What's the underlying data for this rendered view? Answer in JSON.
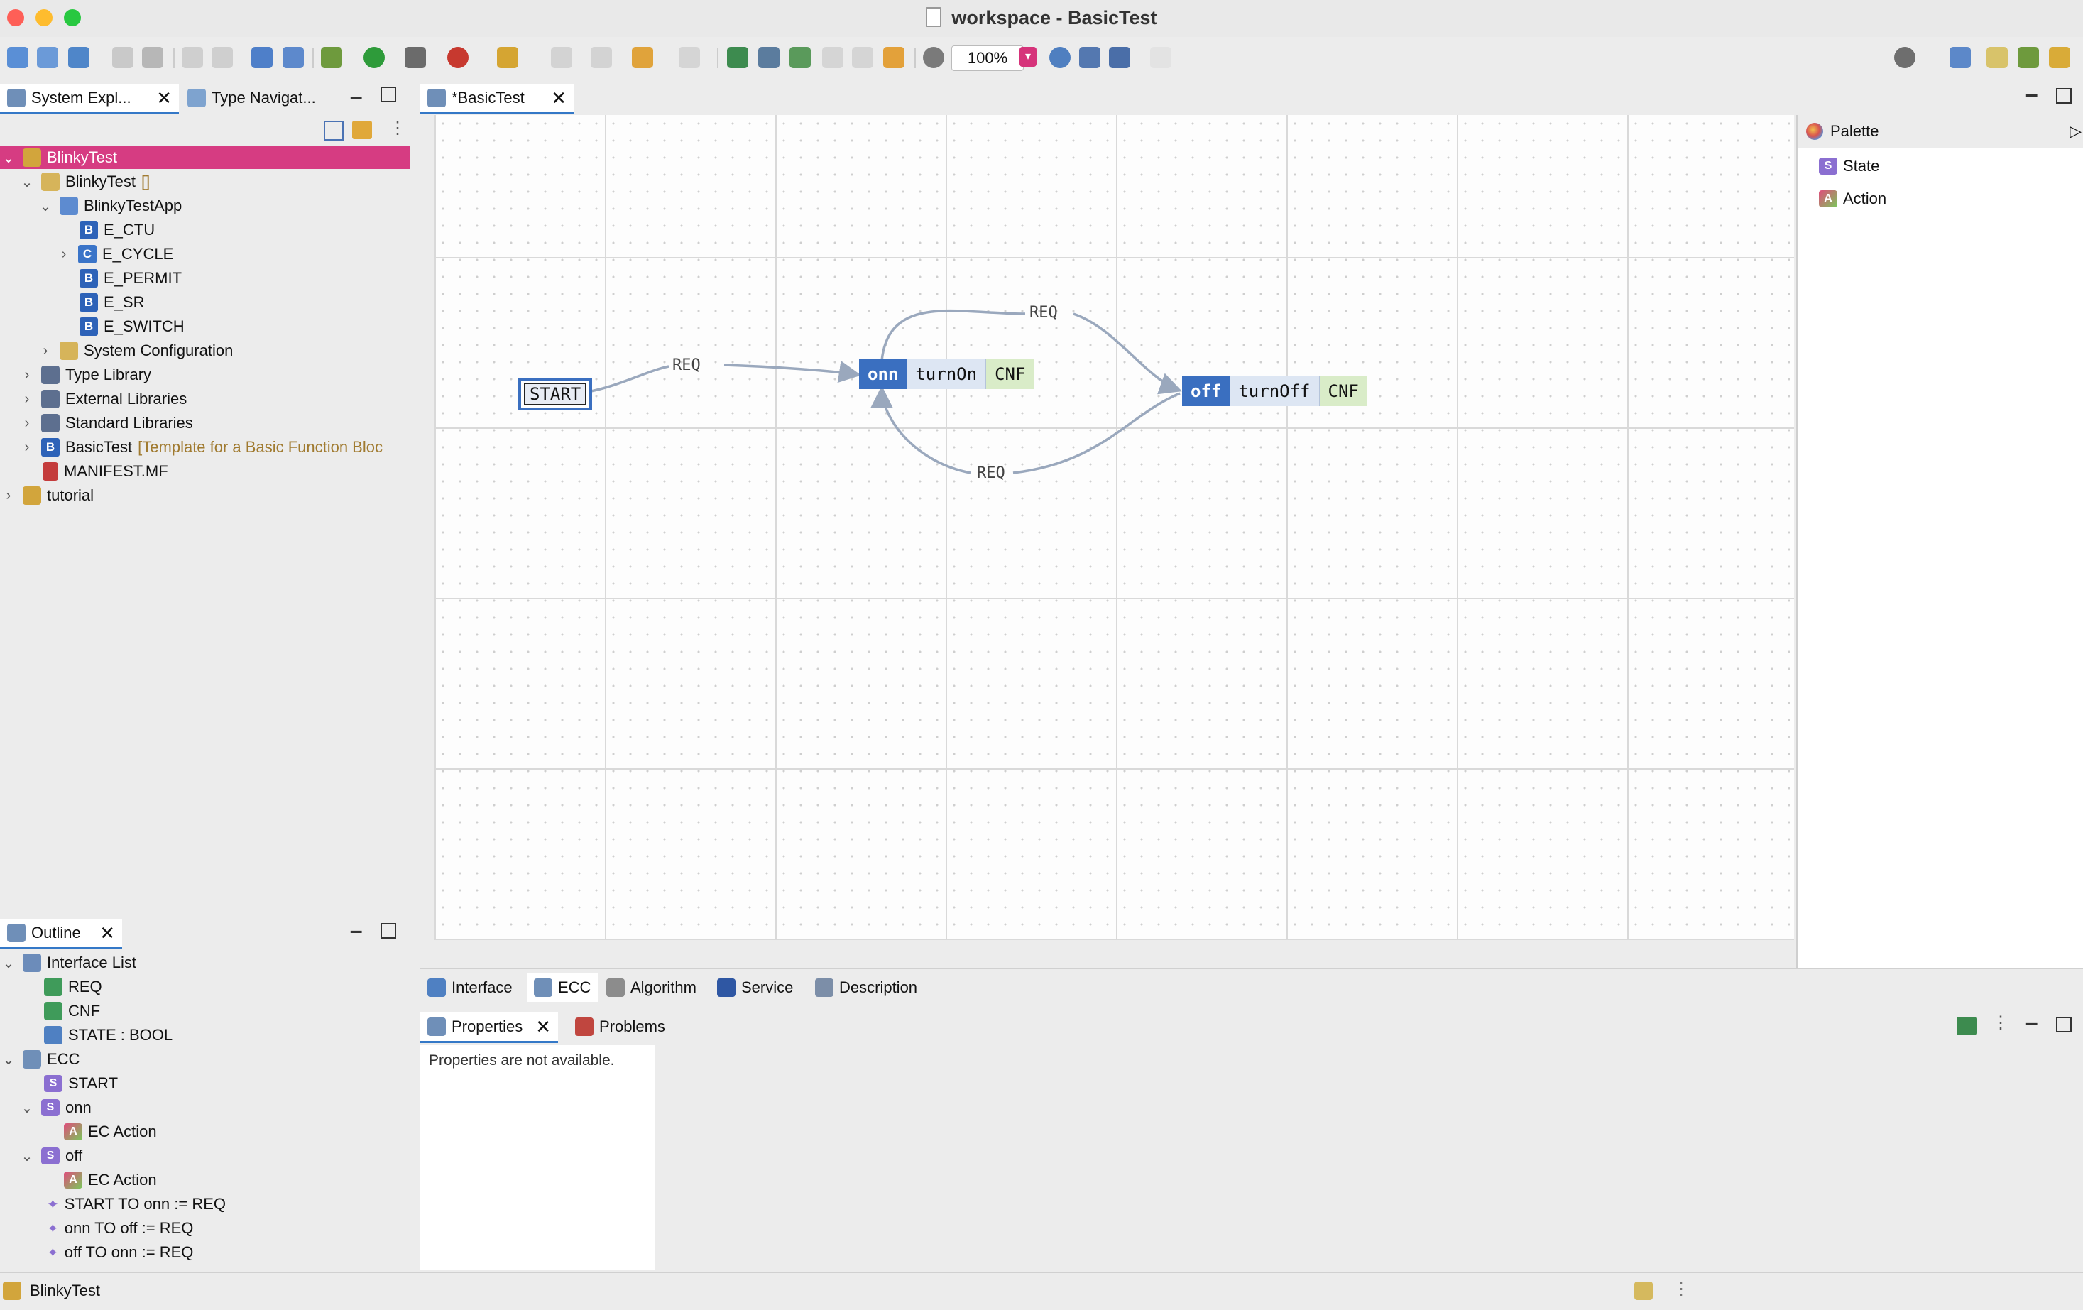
{
  "window": {
    "title": "workspace - BasicTest"
  },
  "toolbar": {
    "zoom": "100%"
  },
  "left_tabs": [
    {
      "label": "System Expl..."
    },
    {
      "label": "Type Navigat..."
    }
  ],
  "tree": [
    {
      "label": "BlinkyTest",
      "suffix": ""
    },
    {
      "label": "BlinkyTest",
      "suffix": "[]"
    },
    {
      "label": "BlinkyTestApp",
      "suffix": ""
    },
    {
      "label": "E_CTU",
      "suffix": ""
    },
    {
      "label": "E_CYCLE",
      "suffix": ""
    },
    {
      "label": "E_PERMIT",
      "suffix": ""
    },
    {
      "label": "E_SR",
      "suffix": ""
    },
    {
      "label": "E_SWITCH",
      "suffix": ""
    },
    {
      "label": "System Configuration",
      "suffix": ""
    },
    {
      "label": "Type Library",
      "suffix": ""
    },
    {
      "label": "External Libraries",
      "suffix": ""
    },
    {
      "label": "Standard Libraries",
      "suffix": ""
    },
    {
      "label": "BasicTest",
      "suffix": "[Template for a Basic Function Bloc"
    },
    {
      "label": "MANIFEST.MF",
      "suffix": ""
    },
    {
      "label": "tutorial",
      "suffix": ""
    }
  ],
  "outline": {
    "tab": "Outline",
    "items": [
      "Interface List",
      "REQ",
      "CNF",
      "STATE : BOOL",
      "ECC",
      "START",
      "onn",
      "EC Action",
      "off",
      "EC Action",
      "START TO onn := REQ",
      "onn TO off := REQ",
      "off TO onn := REQ"
    ]
  },
  "editor": {
    "tab": "*BasicTest",
    "states": {
      "start": "START",
      "onn": {
        "name": "onn",
        "algorithm": "turnOn",
        "output": "CNF"
      },
      "off": {
        "name": "off",
        "algorithm": "turnOff",
        "output": "CNF"
      }
    },
    "transitions": {
      "t1": "REQ",
      "t2": "REQ",
      "t3": "REQ"
    }
  },
  "palette": {
    "title": "Palette",
    "items": [
      "State",
      "Action"
    ]
  },
  "editor_tabs": [
    "Interface",
    "ECC",
    "Algorithm",
    "Service",
    "Description"
  ],
  "bottom_tabs": {
    "properties": "Properties",
    "problems": "Problems",
    "message": "Properties are not available."
  },
  "status": {
    "text": "BlinkyTest"
  },
  "colors": {
    "selection": "#d63c82",
    "state_blue": "#3a6fc0",
    "action_alg": "#dde6f3",
    "action_out": "#d9ecc8"
  }
}
